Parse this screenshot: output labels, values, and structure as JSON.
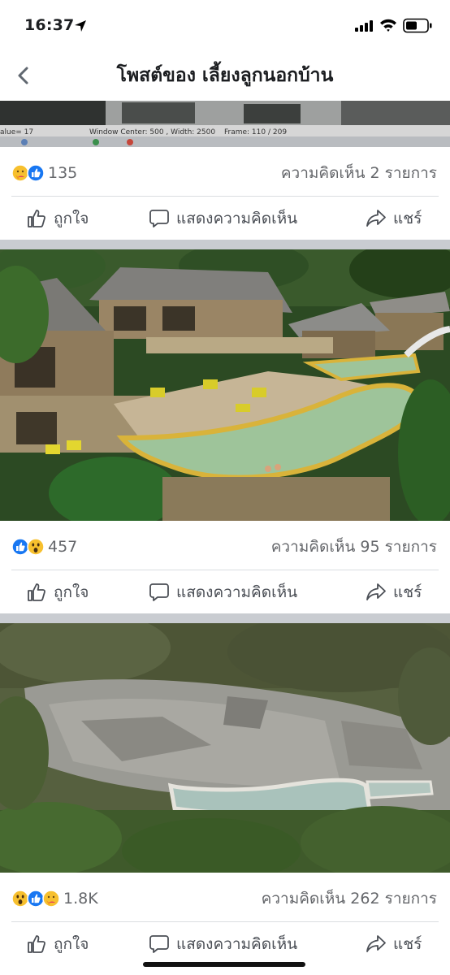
{
  "status_bar": {
    "time": "16:37"
  },
  "header": {
    "title": "โพสต์ของ เลี้ยงลูกนอกบ้าน"
  },
  "posts": [
    {
      "image_text": {
        "value": "alue= 17",
        "window": "Window Center: 500 , Width: 2500",
        "frame": "Frame: 110 / 209"
      },
      "reactions": [
        "care",
        "like"
      ],
      "reaction_count": "135",
      "comments": "ความคิดเห็น 2 รายการ"
    },
    {
      "reactions": [
        "like",
        "wow"
      ],
      "reaction_count": "457",
      "comments": "ความคิดเห็น 95 รายการ"
    },
    {
      "reactions": [
        "wow",
        "like",
        "care"
      ],
      "reaction_count": "1.8K",
      "comments": "ความคิดเห็น 262 รายการ"
    }
  ],
  "actions": {
    "like": "ถูกใจ",
    "comment": "แสดงความคิดเห็น",
    "share": "แชร์"
  },
  "colors": {
    "like_blue": "#1877f2",
    "reaction_yellow": "#f7c02e",
    "divider": "#dadde1",
    "section_gray": "#c9ccd1",
    "muted_text": "#65676b"
  }
}
